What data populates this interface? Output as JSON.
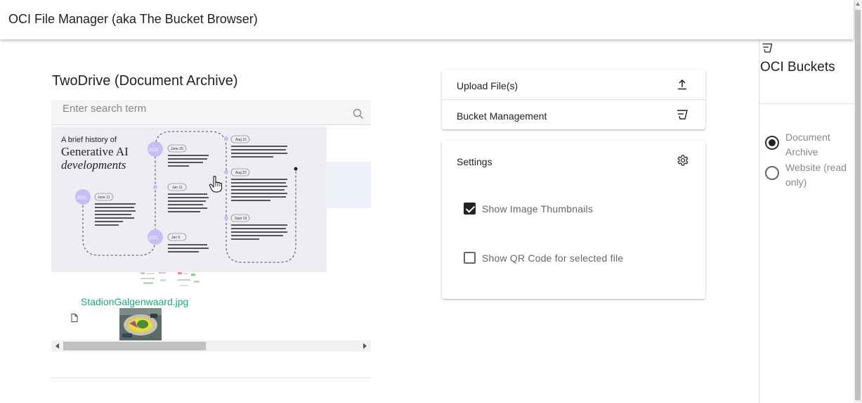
{
  "app": {
    "title": "OCI File Manager (aka The Bucket Browser)"
  },
  "panel": {
    "title": "TwoDrive (Document Archive)",
    "search": {
      "placeholder": "Enter search term",
      "value": ""
    },
    "files": [
      {
        "name": "StadionGalgenwaard.jpg",
        "icon": "file-icon"
      }
    ],
    "preview": {
      "heading_line1": "A brief history of",
      "heading_line2": "Generative AI",
      "heading_line3": "developments",
      "years": [
        "2022",
        "2020",
        "2021"
      ],
      "events": [
        {
          "date": "June 20",
          "text": "DALL-E 2 beta was released and then opened to everyone by September. In November OpenAI released its API."
        },
        {
          "date": "Jan 11",
          "text": "Jasper (a generative AI copywriting and image creation tool) was established in Austin, Texas. The now Unicorn company raised $125 million in October 2022 and announced a new Chrome chat interface in December 2022."
        },
        {
          "date": "June 11",
          "text": "OpenAI released language model GPT-3 (Generative Pre-trained Transformer 3). It was considered a breakthrough in natural language processing with its ability to generate coherent, human-sounding text."
        },
        {
          "date": "Jan 5",
          "text": "Built on the back of GPT-3, OpenAI released DALL-E, enabling people to create images from text."
        },
        {
          "date": "Aug 15",
          "text": "Google's DeepMind released Transframer, a generative AI architecture that can create 30-second videos from a single image along with a range of other computer vision tasks."
        },
        {
          "date": "Aug 22",
          "text": "Stability AI released Stable Diffusion, an open-source text-to-image model which earned 10,000 GitHub stars in its first two weeks of release. By October 17, 2022, the model was downloaded 200,000 times. The company then raised $101M giving it unicorn status."
        },
        {
          "date": "Sept 19",
          "text": "Sequoia Capital predicts that by 2030 AI will be producing better finished content, code images and more personalised gaming experiences than professional human creators."
        }
      ]
    }
  },
  "actions": {
    "upload_label": "Upload File(s)",
    "upload_icon": "upload-icon",
    "bucket_label": "Bucket Management",
    "bucket_icon": "bucket-icon"
  },
  "settings": {
    "title": "Settings",
    "options": [
      {
        "label": "Show Image Thumbnails",
        "checked": true
      },
      {
        "label": "Show QR Code for selected file",
        "checked": false
      }
    ]
  },
  "drawer": {
    "title": "OCI Buckets",
    "buckets": [
      {
        "label": "Document Archive",
        "selected": true
      },
      {
        "label": "Website (read only)",
        "selected": false
      }
    ]
  },
  "colors": {
    "file_link": "#19a974",
    "preview_bg": "#efedf3",
    "timeline_accent": "#c9bdf5"
  }
}
